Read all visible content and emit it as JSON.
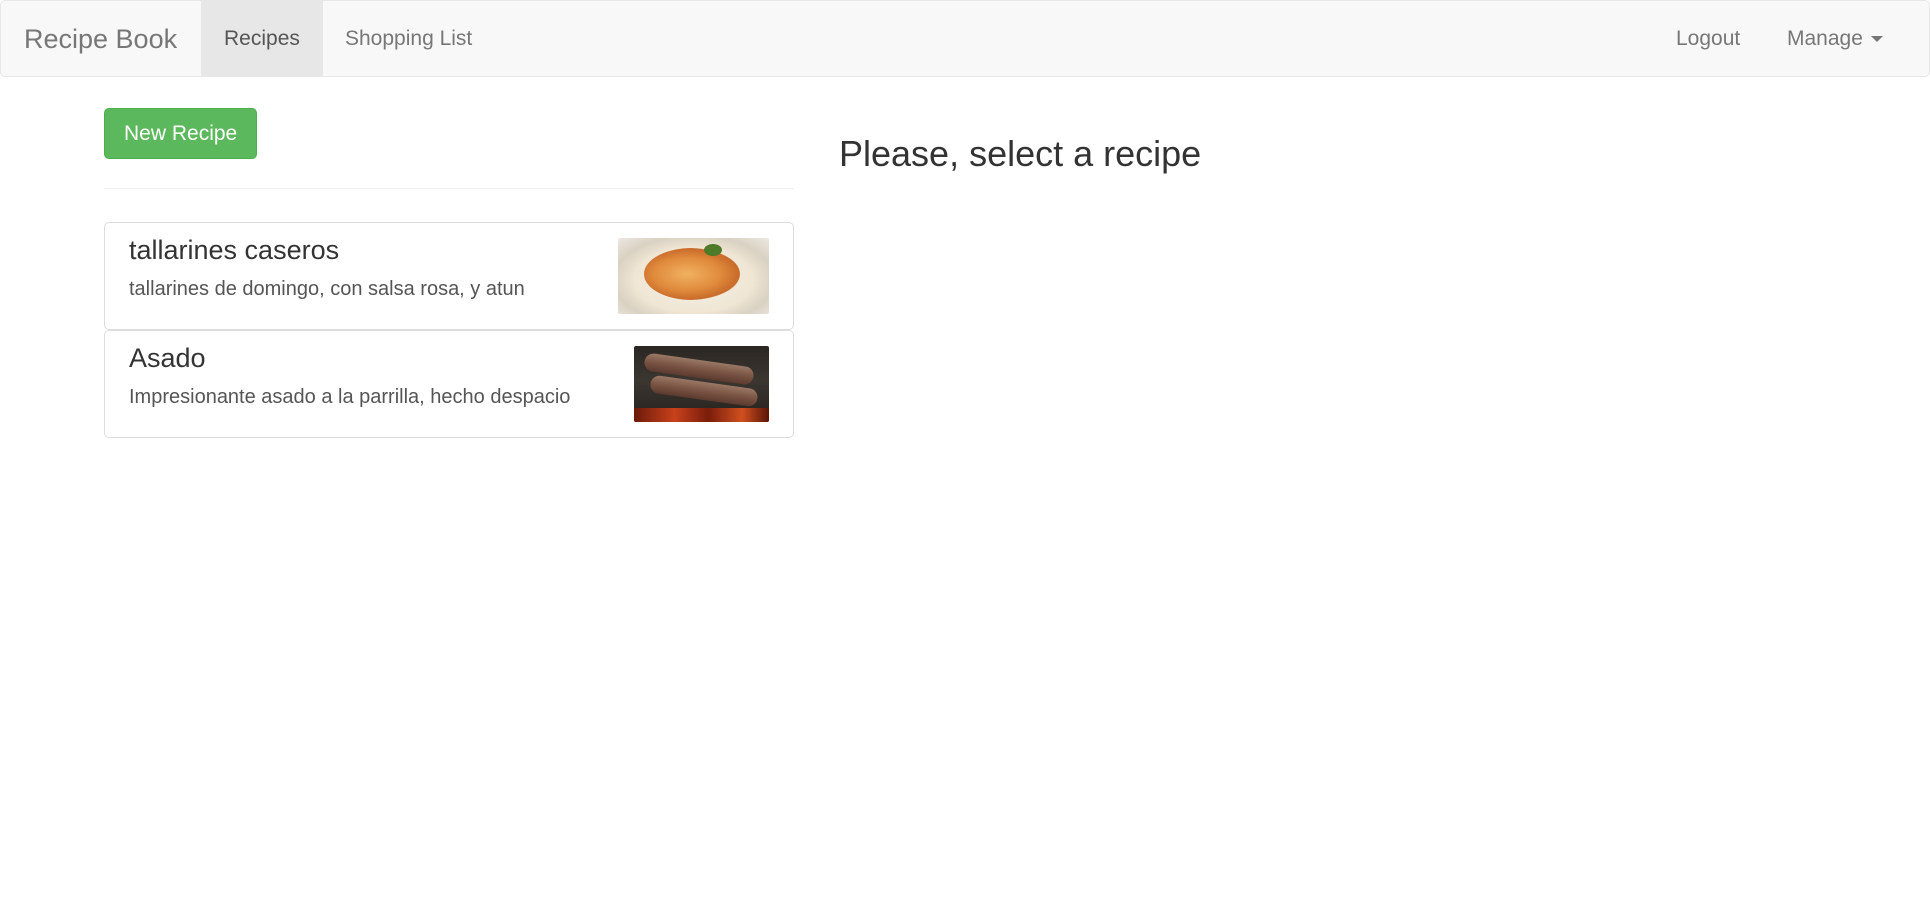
{
  "navbar": {
    "brand": "Recipe Book",
    "items": [
      {
        "label": "Recipes",
        "active": true
      },
      {
        "label": "Shopping List",
        "active": false
      }
    ],
    "right_items": [
      {
        "label": "Logout"
      },
      {
        "label": "Manage",
        "dropdown": true
      }
    ]
  },
  "sidebar": {
    "new_recipe_label": "New Recipe",
    "recipes": [
      {
        "name": "tallarines caseros",
        "description": "tallarines de domingo, con salsa rosa, y atun",
        "image_icon": "pasta-dish-image"
      },
      {
        "name": "Asado",
        "description": "Impresionante asado a la parrilla, hecho despacio",
        "image_icon": "grilled-meat-image"
      }
    ]
  },
  "main": {
    "placeholder_title": "Please, select a recipe"
  },
  "colors": {
    "navbar_bg": "#f8f8f8",
    "active_tab_bg": "#e7e7e7",
    "success_button": "#5cb85c"
  }
}
